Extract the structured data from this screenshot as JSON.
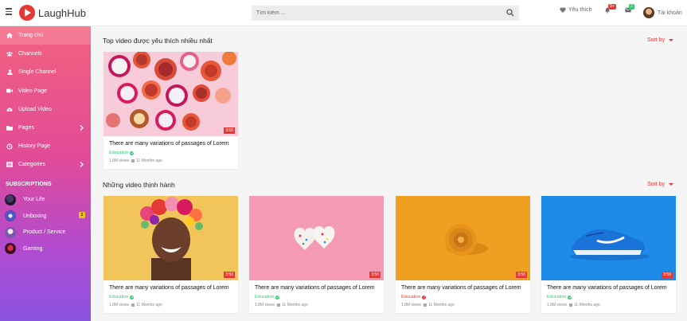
{
  "app": {
    "brand": "LaughHub"
  },
  "search": {
    "placeholder": "Tìm kiếm ..."
  },
  "header": {
    "favorites_label": "Yêu thích",
    "notifications_count": "9+",
    "messages_count": "2",
    "account_label": "Tài khoản"
  },
  "sidebar": {
    "items": [
      {
        "label": "Trang chủ",
        "icon": "home-icon"
      },
      {
        "label": "Channels",
        "icon": "users-icon"
      },
      {
        "label": "Single Channel",
        "icon": "user-icon"
      },
      {
        "label": "Video Page",
        "icon": "video-icon"
      },
      {
        "label": "Upload Video",
        "icon": "cloud-upload-icon"
      },
      {
        "label": "Pages",
        "icon": "folder-icon"
      },
      {
        "label": "History Page",
        "icon": "history-icon"
      },
      {
        "label": "Categories",
        "icon": "list-icon"
      }
    ],
    "subscriptions_title": "SUBSCRIPTIONS",
    "subscriptions": [
      {
        "label": "Your Life"
      },
      {
        "label": "Unboxing",
        "badge": "2"
      },
      {
        "label": "Product / Service"
      },
      {
        "label": "Gaming"
      }
    ]
  },
  "sections": [
    {
      "title": "Top video được yêu thích nhiều nhất",
      "sort_label": "Sort by",
      "videos": [
        {
          "title": "There are many variations of passages of Lorem",
          "category": "Education",
          "views": "1.8M views",
          "age": "11 Months ago",
          "duration": "3:50"
        }
      ]
    },
    {
      "title": "Những video thịnh hành",
      "sort_label": "Sort by",
      "videos": [
        {
          "title": "There are many variations of passages of Lorem",
          "category": "Education",
          "views": "1.8M views",
          "age": "11 Months ago",
          "duration": "3:50"
        },
        {
          "title": "There are many variations of passages of Lorem",
          "category": "Education",
          "views": "1.8M views",
          "age": "11 Months ago",
          "duration": "3:50"
        },
        {
          "title": "There are many variations of passages of Lorem",
          "category": "Education",
          "views": "1.8M views",
          "age": "11 Months ago",
          "duration": "3:50"
        },
        {
          "title": "There are many variations of passages of Lorem",
          "category": "Education",
          "views": "1.8M views",
          "age": "11 Months ago",
          "duration": "3:50"
        }
      ]
    }
  ],
  "colors": {
    "accent": "#e53935",
    "verified": "#2ecc71"
  }
}
